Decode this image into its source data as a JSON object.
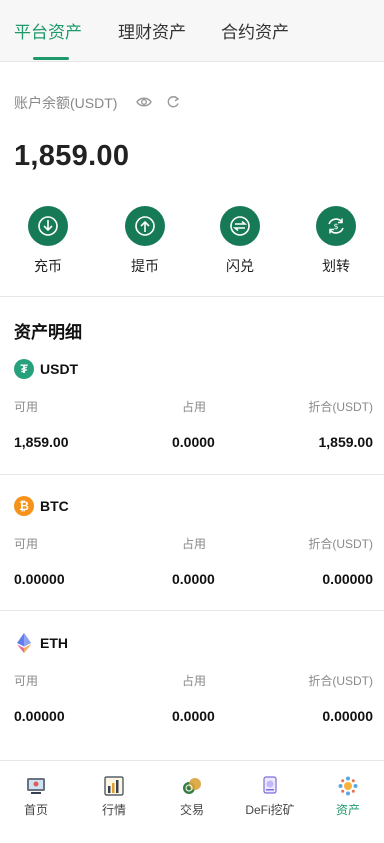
{
  "tabs": [
    {
      "label": "平台资产",
      "active": true
    },
    {
      "label": "理财资产",
      "active": false
    },
    {
      "label": "合约资产",
      "active": false
    }
  ],
  "balance": {
    "label": "账户余额(USDT)",
    "value": "1,859.00"
  },
  "actions": [
    {
      "label": "充币",
      "icon": "deposit-icon"
    },
    {
      "label": "提币",
      "icon": "withdraw-icon"
    },
    {
      "label": "闪兑",
      "icon": "swap-icon"
    },
    {
      "label": "划转",
      "icon": "transfer-icon"
    }
  ],
  "details": {
    "title": "资产明细",
    "assets": [
      {
        "name": "USDT",
        "icon": "usdt-icon",
        "color": "#26a17b",
        "available_label": "可用",
        "frozen_label": "占用",
        "converted_label": "折合(USDT)",
        "available": "1,859.00",
        "frozen": "0.0000",
        "converted": "1,859.00"
      },
      {
        "name": "BTC",
        "icon": "btc-icon",
        "color": "#f7931a",
        "available_label": "可用",
        "frozen_label": "占用",
        "converted_label": "折合(USDT)",
        "available": "0.00000",
        "frozen": "0.0000",
        "converted": "0.00000"
      },
      {
        "name": "ETH",
        "icon": "eth-icon",
        "color": "#627eea",
        "available_label": "可用",
        "frozen_label": "占用",
        "converted_label": "折合(USDT)",
        "available": "0.00000",
        "frozen": "0.0000",
        "converted": "0.00000"
      }
    ]
  },
  "bottom_nav": [
    {
      "label": "首页",
      "icon": "home-icon",
      "active": false
    },
    {
      "label": "行情",
      "icon": "market-icon",
      "active": false
    },
    {
      "label": "交易",
      "icon": "trade-icon",
      "active": false
    },
    {
      "label": "DeFi挖矿",
      "icon": "defi-mining-icon",
      "active": false
    },
    {
      "label": "资产",
      "icon": "assets-icon",
      "active": true
    }
  ],
  "colors": {
    "accent": "#1e9a6a",
    "action_circle": "#167a57"
  }
}
